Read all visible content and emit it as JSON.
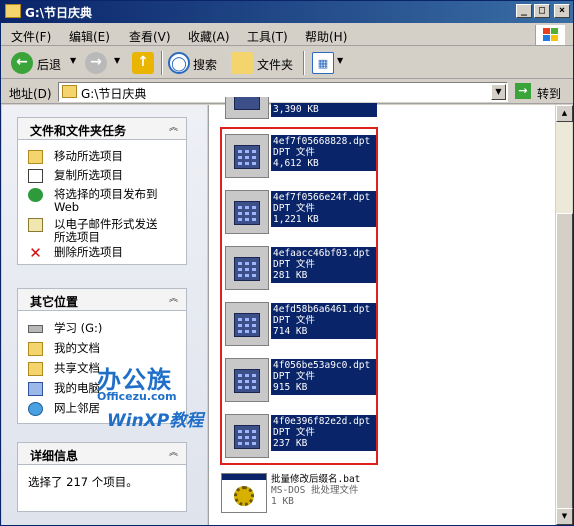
{
  "window": {
    "title": "G:\\节日庆典"
  },
  "menu": [
    "文件(F)",
    "编辑(E)",
    "查看(V)",
    "收藏(A)",
    "工具(T)",
    "帮助(H)"
  ],
  "toolbar": {
    "back": "后退",
    "search": "搜索",
    "folders": "文件夹"
  },
  "address": {
    "label": "地址(D)",
    "value": "G:\\节日庆典",
    "go": "转到"
  },
  "tasks": {
    "title": "文件和文件夹任务",
    "items": [
      "移动所选项目",
      "复制所选项目",
      "将选择的项目发布到",
      "Web",
      "以电子邮件形式发送",
      "所选项目",
      "删除所选项目"
    ]
  },
  "places": {
    "title": "其它位置",
    "items": [
      "学习 (G:)",
      "我的文档",
      "共享文档",
      "我的电脑",
      "网上邻居"
    ]
  },
  "details": {
    "title": "详细信息",
    "text": "选择了 217 个项目。"
  },
  "watermark": {
    "brand": "办公族",
    "site": "Officezu.com",
    "tag": "WinXP教程"
  },
  "files": {
    "partial_size": "3,390 KB",
    "items": [
      {
        "name": "4ef7f05668828.dpt",
        "type": "DPT 文件",
        "size": "4,612 KB"
      },
      {
        "name": "4ef7f0566e24f.dpt",
        "type": "DPT 文件",
        "size": "1,221 KB"
      },
      {
        "name": "4efaacc46bf03.dpt",
        "type": "DPT 文件",
        "size": "281 KB"
      },
      {
        "name": "4efd58b6a6461.dpt",
        "type": "DPT 文件",
        "size": "714 KB"
      },
      {
        "name": "4f056be53a9c0.dpt",
        "type": "DPT 文件",
        "size": "915 KB"
      },
      {
        "name": "4f0e396f82e2d.dpt",
        "type": "DPT 文件",
        "size": "237 KB"
      }
    ],
    "bat": {
      "name": "批量修改后缀名.bat",
      "type": "MS-DOS 批处理文件",
      "size": "1 KB"
    }
  },
  "colors": {
    "selection": "#0a246a",
    "highlight_box": "#e0201c",
    "title_bar": "#0a246a"
  }
}
